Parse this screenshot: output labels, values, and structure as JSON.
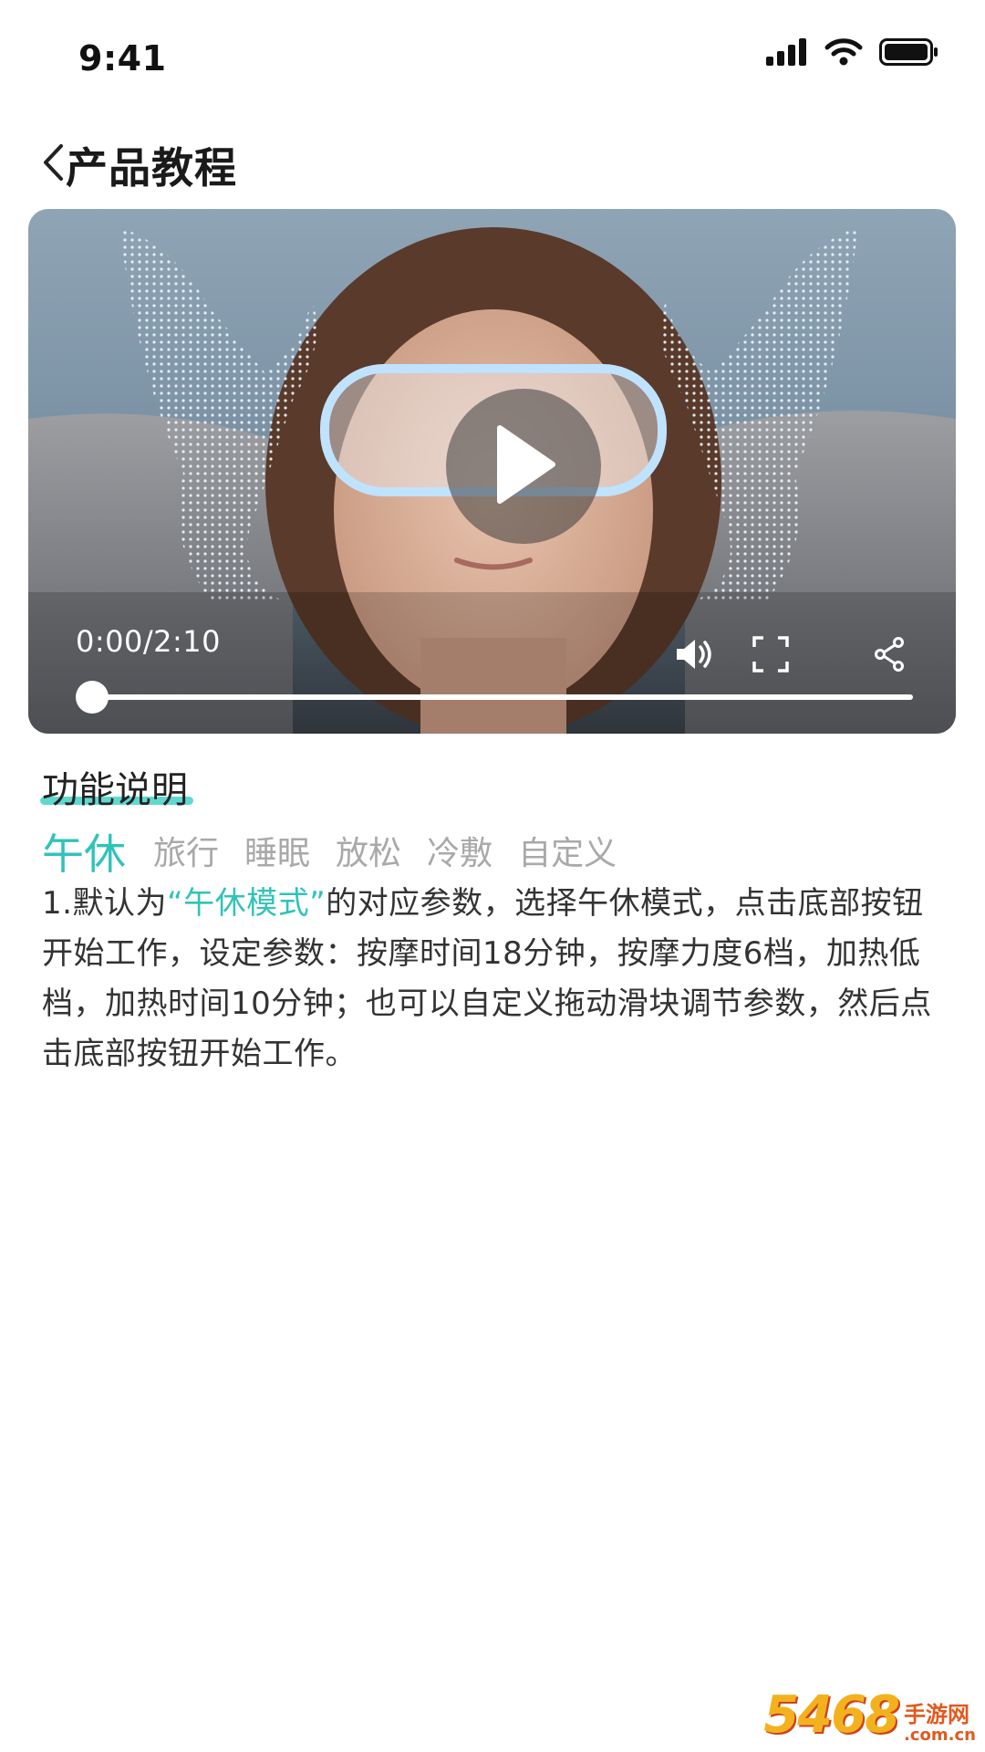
{
  "status_bar": {
    "time": "9:41"
  },
  "header": {
    "title": "产品教程"
  },
  "video": {
    "time_display": "0:00/2:10",
    "progress": 0
  },
  "section": {
    "title": "功能说明"
  },
  "mode_tabs": [
    {
      "label": "午休",
      "active": true
    },
    {
      "label": "旅行",
      "active": false
    },
    {
      "label": "睡眠",
      "active": false
    },
    {
      "label": "放松",
      "active": false
    },
    {
      "label": "冷敷",
      "active": false
    },
    {
      "label": "自定义",
      "active": false
    }
  ],
  "description": {
    "prefix": "1.默认为",
    "highlight": "“午休模式”",
    "suffix": "的对应参数，选择午休模式，点击底部按钮开始工作，设定参数：按摩时间18分钟，按摩力度6档，加热低档，加热时间10分钟；也可以自定义拖动滑块调节参数，然后点击底部按钮开始工作。"
  },
  "watermark": {
    "number": "5468",
    "cn": "手游网",
    "domain": ".com.cn"
  },
  "colors": {
    "accent": "#30c3b9",
    "underline": "#43d1c8",
    "inactive_tab": "#a9a9a9"
  },
  "icons": [
    "chevron-left-icon",
    "signal-icon",
    "wifi-icon",
    "battery-icon",
    "play-icon",
    "volume-icon",
    "fullscreen-icon",
    "share-icon"
  ]
}
